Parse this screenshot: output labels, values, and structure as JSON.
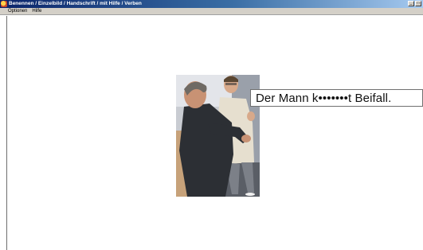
{
  "window": {
    "title": "Benennen / Einzelbild / Handschrift / mit Hilfe / Verben",
    "controls": [
      "_",
      "□"
    ]
  },
  "menu": {
    "items": [
      {
        "label": "Optionen"
      },
      {
        "label": "Hilfe"
      }
    ]
  },
  "exercise": {
    "sentence_prefix": "Der Mann k",
    "hidden_letters": "•••••••",
    "sentence_suffix": "t Beifall."
  }
}
